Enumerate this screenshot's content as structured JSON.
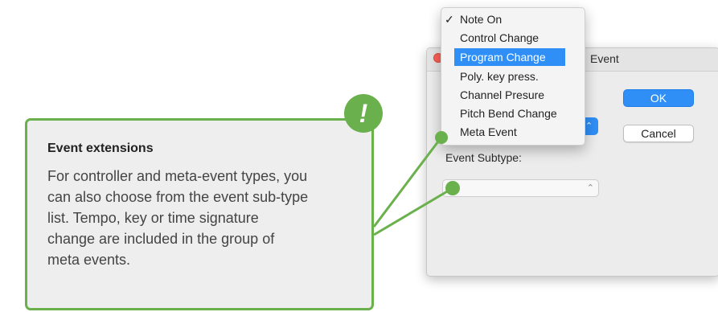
{
  "dialog": {
    "title": "Event",
    "ok_label": "OK",
    "cancel_label": "Cancel",
    "type_stepper_icon": "chevron-up-down-icon",
    "subtype_label": "Event Subtype:",
    "subtype_value": "",
    "subtype_chevron": "⌃⌄"
  },
  "event_type_menu": {
    "items": [
      {
        "label": "Note On",
        "checked": true
      },
      {
        "label": "Control Change"
      },
      {
        "label": "Program Change",
        "highlighted": true
      },
      {
        "label": "Poly. key press."
      },
      {
        "label": "Channel Presure"
      },
      {
        "label": "Pitch Bend Change"
      },
      {
        "label": "Meta Event"
      }
    ],
    "check_mark": "✓"
  },
  "callout": {
    "title": "Event extensions",
    "body": "For controller and meta-event types, you can also choose from the event sub-type list. Tempo, key or time signature change are included in the group of meta events.",
    "badge": "!",
    "accent_color": "#6ab04c"
  }
}
